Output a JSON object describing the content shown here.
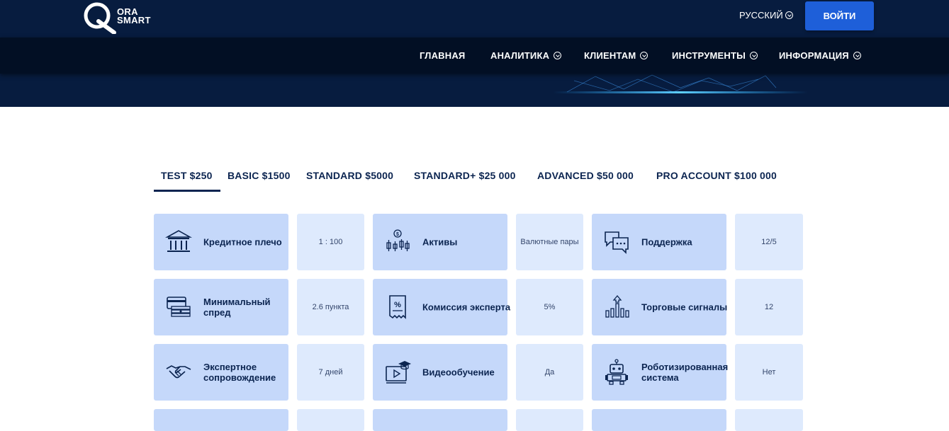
{
  "header": {
    "logo_text_line1": "ORA",
    "logo_text_line2": "SMART",
    "language": "РУССКИЙ",
    "login_label": "ВОЙТИ"
  },
  "nav": {
    "items": [
      {
        "label": "ГЛАВНАЯ",
        "has_dropdown": false
      },
      {
        "label": "АНАЛИТИКА",
        "has_dropdown": true
      },
      {
        "label": "КЛИЕНТАМ",
        "has_dropdown": true
      },
      {
        "label": "ИНСТРУМЕНТЫ",
        "has_dropdown": true
      },
      {
        "label": "ИНФОРМАЦИЯ",
        "has_dropdown": true
      }
    ]
  },
  "tabs": [
    {
      "label": "TEST $250",
      "active": true
    },
    {
      "label": "BASIC $1500",
      "active": false
    },
    {
      "label": "STANDARD $5000",
      "active": false
    },
    {
      "label": "STANDARD+ $25 000",
      "active": false
    },
    {
      "label": "ADVANCED $50 000",
      "active": false
    },
    {
      "label": "PRO ACCOUNT $100 000",
      "active": false
    }
  ],
  "features": [
    [
      {
        "icon": "bank-icon",
        "label": "Кредитное плечо",
        "value": "1 : 100"
      },
      {
        "icon": "assets-candles-icon",
        "label": "Активы",
        "value": "Валютные пары"
      },
      {
        "icon": "chat-support-icon",
        "label": "Поддержка",
        "value": "12/5"
      }
    ],
    [
      {
        "icon": "cash-cards-icon",
        "label": "Минимальный спред",
        "value": "2.6 пункта"
      },
      {
        "icon": "receipt-percent-icon",
        "label": "Комиссия эксперта",
        "value": "5%"
      },
      {
        "icon": "bar-chart-arrow-icon",
        "label": "Торговые сигналы",
        "value": "12"
      }
    ],
    [
      {
        "icon": "handshake-icon",
        "label": "Экспертное сопровождение",
        "value": "7 дней"
      },
      {
        "icon": "video-education-icon",
        "label": "Видеообучение",
        "value": "Да"
      },
      {
        "icon": "robot-icon",
        "label": "Роботизированная система",
        "value": "Нет"
      }
    ]
  ],
  "colors": {
    "header_bg": "#071c3f",
    "nav_bg": "#020f24",
    "button_blue": "#1e5fd9",
    "label_card": "#c5d8fa",
    "value_card": "#deeafd",
    "text_dark": "#0b2450"
  }
}
